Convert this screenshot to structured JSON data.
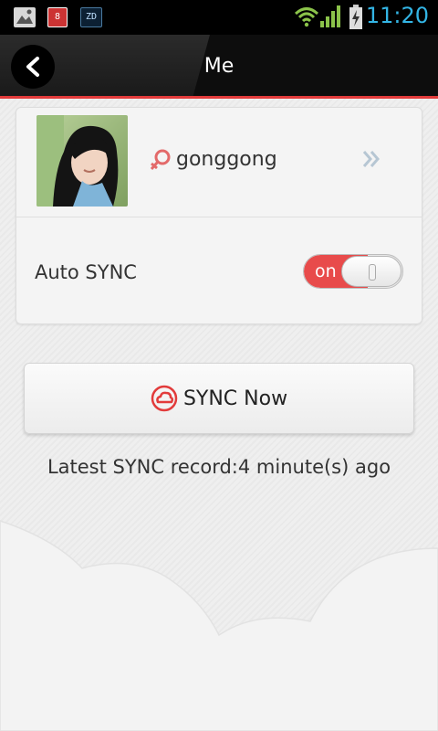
{
  "status_bar": {
    "clock": "11:20",
    "notif_badge": "8",
    "app_badge": "ZD"
  },
  "header": {
    "title": "Me"
  },
  "profile": {
    "username": "gonggong",
    "gender": "female"
  },
  "settings": {
    "auto_sync_label": "Auto SYNC",
    "toggle_state": "on"
  },
  "sync": {
    "button_label": "SYNC Now",
    "latest_record": "Latest SYNC record:4 minute(s) ago"
  },
  "colors": {
    "accent": "#e23b3b",
    "status_clock": "#33b5e5"
  }
}
